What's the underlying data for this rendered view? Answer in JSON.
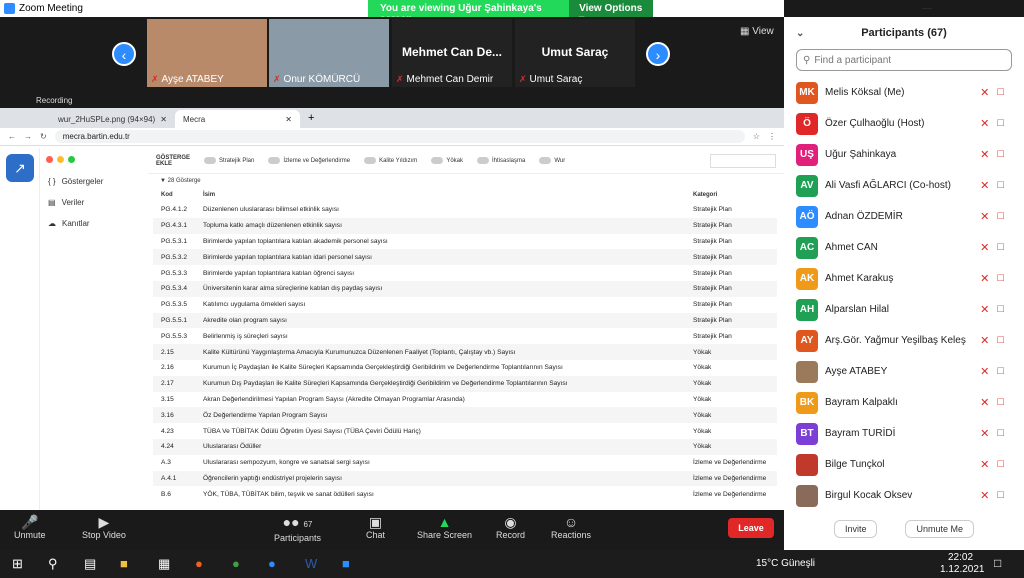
{
  "window": {
    "title": "Zoom Meeting"
  },
  "banner": {
    "text": "You are viewing Uğur Şahinkaya's screen",
    "options": "View Options"
  },
  "strip": {
    "view_label": "View",
    "tiles": [
      {
        "name": "Ayşe ATABEY",
        "bg": "#b88a6a"
      },
      {
        "name": "Onur KÖMÜRCÜ",
        "bg": "#8a9aa6"
      },
      {
        "name": "Mehmet Can Demir",
        "big": "Mehmet Can De..."
      },
      {
        "name": "Umut Saraç",
        "big": "Umut Saraç"
      }
    ]
  },
  "recording": "Recording",
  "browser": {
    "tabs": [
      {
        "label": "wur_2HuSPLe.png (94×94)"
      },
      {
        "label": "Mecra"
      }
    ],
    "url": "mecra.bartin.edu.tr"
  },
  "app": {
    "side": [
      "Göstergeler",
      "Veriler",
      "Kanıtlar"
    ],
    "filter": {
      "title": "GÖSTERGE EKLE",
      "toggles": [
        "Stratejik Plan",
        "İzleme ve Değerlendirme",
        "Kalite Yıldızım",
        "Yökak",
        "İhtisaslaşma",
        "Wur"
      ]
    },
    "count": "28 Gösterge",
    "headers": [
      "Kod",
      "İsim",
      "Kategori"
    ],
    "rows": [
      [
        "PG.4.1.2",
        "Düzenlenen uluslararası bilimsel etkinlik sayısı",
        "Stratejik Plan"
      ],
      [
        "PG.4.3.1",
        "Topluma katkı amaçlı düzenlenen etkinlik sayısı",
        "Stratejik Plan"
      ],
      [
        "PG.5.3.1",
        "Birimlerde yapılan toplantılara katılan akademik personel sayısı",
        "Stratejik Plan"
      ],
      [
        "PG.5.3.2",
        "Birimlerde yapılan toplantılara katılan idari personel sayısı",
        "Stratejik Plan"
      ],
      [
        "PG.5.3.3",
        "Birimlerde yapılan toplantılara katılan öğrenci sayısı",
        "Stratejik Plan"
      ],
      [
        "PG.5.3.4",
        "Üniversitenin karar alma süreçlerine katılan dış paydaş sayısı",
        "Stratejik Plan"
      ],
      [
        "PG.5.3.5",
        "Katılımcı uygulama örnekleri sayısı",
        "Stratejik Plan"
      ],
      [
        "PG.5.5.1",
        "Akredite olan program sayısı",
        "Stratejik Plan"
      ],
      [
        "PG.5.5.3",
        "Belirlenmiş iş süreçleri sayısı",
        "Stratejik Plan"
      ],
      [
        "2.15",
        "Kalite Kültürünü Yaygınlaştırma Amacıyla Kurumunuzca Düzenlenen Faaliyet (Toplantı, Çalıştay vb.) Sayısı",
        "Yökak"
      ],
      [
        "2.16",
        "Kurumun İç Paydaşları ile Kalite Süreçleri Kapsamında Gerçekleştirdiği Geribildirim ve Değerlendirme Toplantılarının Sayısı",
        "Yökak"
      ],
      [
        "2.17",
        "Kurumun Dış Paydaşları ile Kalite Süreçleri Kapsamında Gerçekleştirdiği Geribildirim ve Değerlendirme Toplantılarının Sayısı",
        "Yökak"
      ],
      [
        "3.15",
        "Akran Değerlendirilmesi Yapılan Program Sayısı (Akredite Olmayan Programlar Arasında)",
        "Yökak"
      ],
      [
        "3.16",
        "Öz Değerlendirme Yapılan Program Sayısı",
        "Yökak"
      ],
      [
        "4.23",
        "TÜBA Ve TÜBİTAK Ödülü Öğretim Üyesi Sayısı (TÜBA Çeviri Ödülü Hariç)",
        "Yökak"
      ],
      [
        "4.24",
        "Uluslararası Ödüller",
        "Yökak"
      ],
      [
        "A.3",
        "Uluslararası sempozyum, kongre ve sanatsal sergi sayısı",
        "İzleme ve Değerlendirme"
      ],
      [
        "A.4.1",
        "Öğrencilerin yaptığı endüstriyel projelerin sayısı",
        "İzleme ve Değerlendirme"
      ],
      [
        "B.6",
        "YÖK, TÜBA, TÜBİTAK bilim, teşvik ve sanat ödülleri sayısı",
        "İzleme ve Değerlendirme"
      ]
    ]
  },
  "participants": {
    "title": "Participants (67)",
    "search_placeholder": "Find a participant",
    "list": [
      {
        "initials": "MK",
        "name": "Melis Köksal (Me)",
        "color": "#e0561f"
      },
      {
        "initials": "Ö",
        "name": "Özer Çulhaoğlu (Host)",
        "color": "#e02828"
      },
      {
        "initials": "UŞ",
        "name": "Uğur Şahinkaya",
        "color": "#e0207a"
      },
      {
        "initials": "AV",
        "name": "Ali Vasfi AĞLARCI (Co-host)",
        "color": "#1fa055"
      },
      {
        "initials": "AÖ",
        "name": "Adnan ÖZDEMİR",
        "color": "#2d8cff"
      },
      {
        "initials": "AC",
        "name": "Ahmet CAN",
        "color": "#1fa055"
      },
      {
        "initials": "AK",
        "name": "Ahmet Karakuş",
        "color": "#f09a1a"
      },
      {
        "initials": "AH",
        "name": "Alparslan Hilal",
        "color": "#1fa055"
      },
      {
        "initials": "AY",
        "name": "Arş.Gör. Yağmur Yeşilbaş Keleş",
        "color": "#e0561f"
      },
      {
        "initials": "",
        "name": "Ayşe ATABEY",
        "color": "#9a7a5a"
      },
      {
        "initials": "BK",
        "name": "Bayram Kalpaklı",
        "color": "#f09a1a"
      },
      {
        "initials": "BT",
        "name": "Bayram TURİDİ",
        "color": "#7b3fd6"
      },
      {
        "initials": "",
        "name": "Bilge Tunçkol",
        "color": "#c0392b"
      },
      {
        "initials": "",
        "name": "Birgul Kocak Oksev",
        "color": "#8a6a5a"
      }
    ],
    "invite": "Invite",
    "unmute": "Unmute Me"
  },
  "toolbar": {
    "unmute": "Unmute",
    "stop_video": "Stop Video",
    "participants": "Participants",
    "participants_count": "67",
    "chat": "Chat",
    "share": "Share Screen",
    "record": "Record",
    "reactions": "Reactions",
    "leave": "Leave"
  },
  "taskbar": {
    "weather": "15°C Güneşli",
    "time": "22:02",
    "date": "1.12.2021"
  }
}
